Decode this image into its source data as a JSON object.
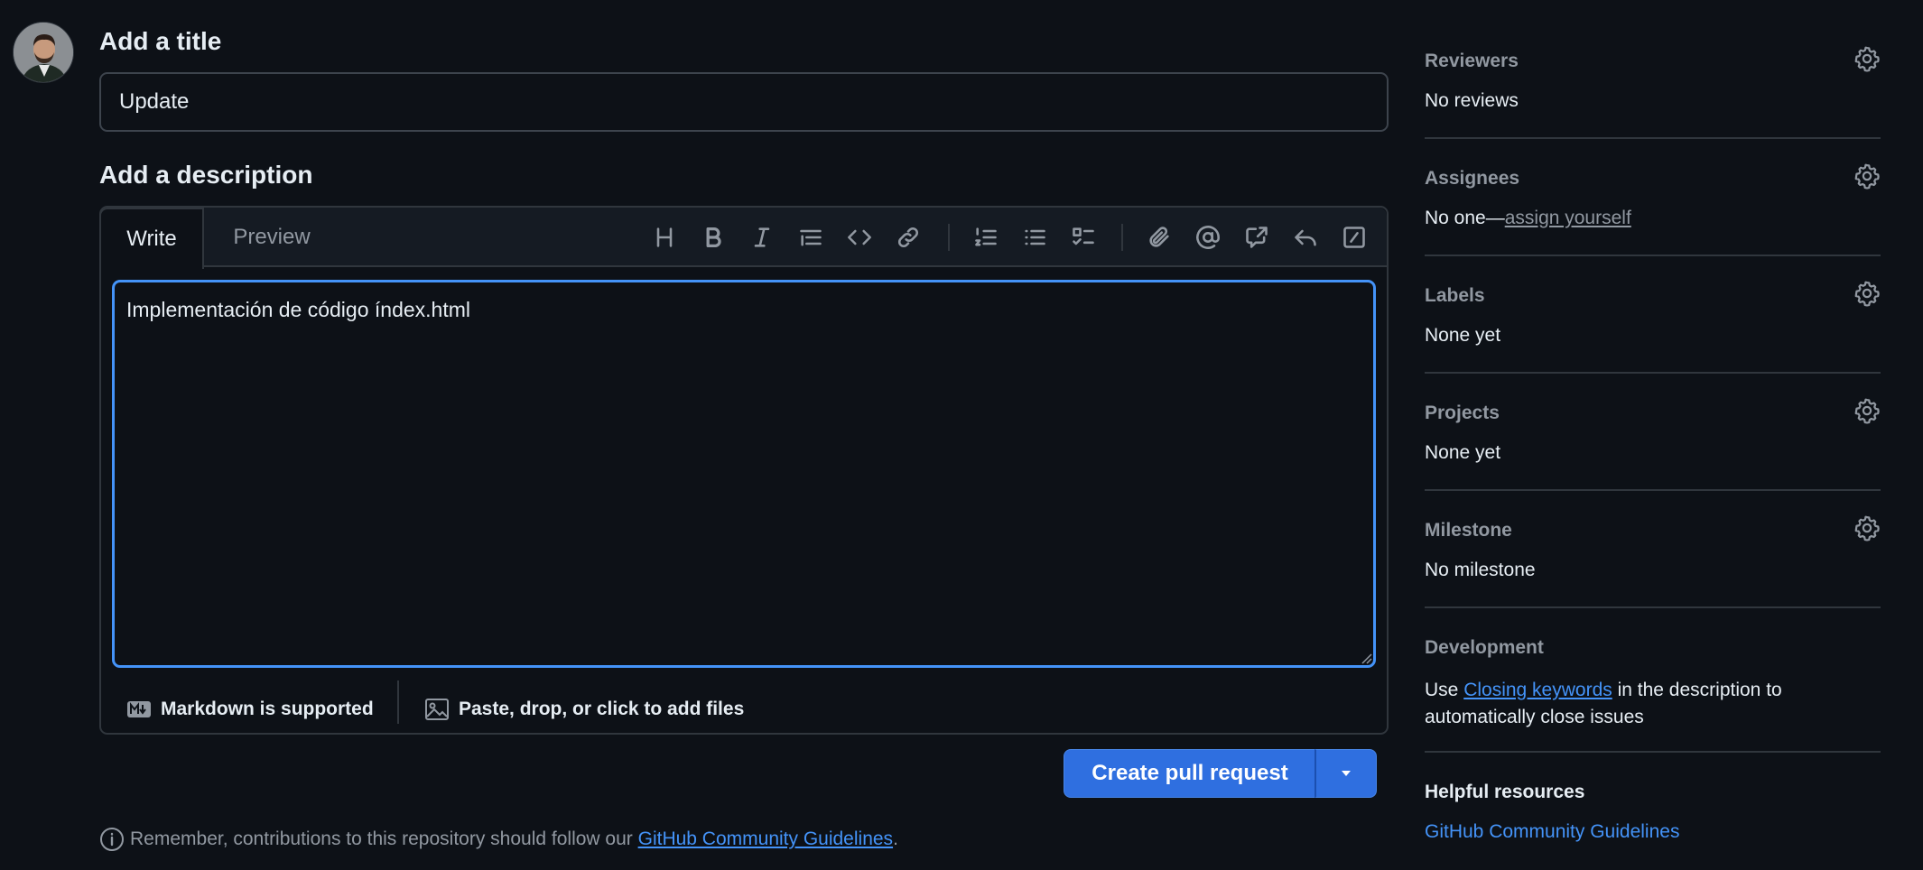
{
  "title_section": {
    "heading": "Add a title",
    "value": "Update"
  },
  "description_section": {
    "heading": "Add a description",
    "tabs": [
      "Write",
      "Preview"
    ],
    "value": "Implementación de código índex.html",
    "markdown_note": "Markdown is supported",
    "attach_note": "Paste, drop, or click to add files"
  },
  "toolbar_icons": [
    "heading-icon",
    "bold-icon",
    "italic-icon",
    "quote-icon",
    "code-icon",
    "link-icon",
    "numbered-list-icon",
    "bulleted-list-icon",
    "task-list-icon",
    "attachment-icon",
    "mention-icon",
    "cross-reference-icon",
    "reply-icon",
    "slash-commands-icon"
  ],
  "actions": {
    "create_label": "Create pull request"
  },
  "notice": {
    "prefix": "Remember, contributions to this repository should follow our ",
    "link": "GitHub Community Guidelines",
    "suffix": "."
  },
  "sidebar": {
    "reviewers": {
      "title": "Reviewers",
      "value": "No reviews"
    },
    "assignees": {
      "title": "Assignees",
      "value_prefix": "No one—",
      "value_link": "assign yourself"
    },
    "labels": {
      "title": "Labels",
      "value": "None yet"
    },
    "projects": {
      "title": "Projects",
      "value": "None yet"
    },
    "milestone": {
      "title": "Milestone",
      "value": "No milestone"
    },
    "development": {
      "title": "Development",
      "prefix": "Use ",
      "link": "Closing keywords",
      "suffix": " in the description to automatically close issues"
    },
    "helpful_resources": {
      "title": "Helpful resources",
      "link": "GitHub Community Guidelines"
    }
  },
  "colors": {
    "accent": "#4493f8",
    "button": "#2f6fe0",
    "background": "#0d1117",
    "border": "#30363d",
    "muted": "#9198a1"
  }
}
